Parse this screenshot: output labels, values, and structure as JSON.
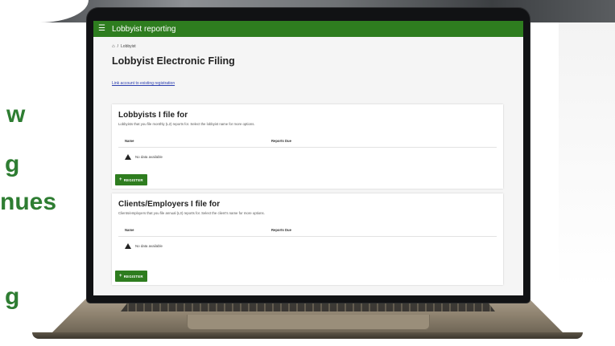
{
  "headline": {
    "lines": [
      "w",
      "g",
      "nues",
      "g"
    ]
  },
  "app": {
    "title": "Lobbyist reporting",
    "breadcrumb": {
      "separator": "/",
      "current": "Lobbyist"
    },
    "page_title": "Lobbyist Electronic Filing",
    "link_label": "Link account to existing registration"
  },
  "lobbyists_card": {
    "title": "Lobbyists I file for",
    "subtitle": "Lobbyists that you file monthly (L2) reports for. Select the lobbyist name for more options.",
    "columns": [
      "Name",
      "Reports Due"
    ],
    "empty_text": "No data available",
    "button_label": "REGISTER"
  },
  "clients_card": {
    "title": "Clients/Employers I file for",
    "subtitle": "Clients/employers that you file annual (L3) reports for. Select the client's name for more options.",
    "columns": [
      "Name",
      "Reports Due"
    ],
    "empty_text": "No data available",
    "button_label": "REGISTER"
  },
  "colors": {
    "brand_green": "#2e7d1f",
    "headline_green": "#2e7d32"
  },
  "icons": [
    "hamburger-icon",
    "home-icon",
    "warning-icon",
    "plus-icon"
  ]
}
